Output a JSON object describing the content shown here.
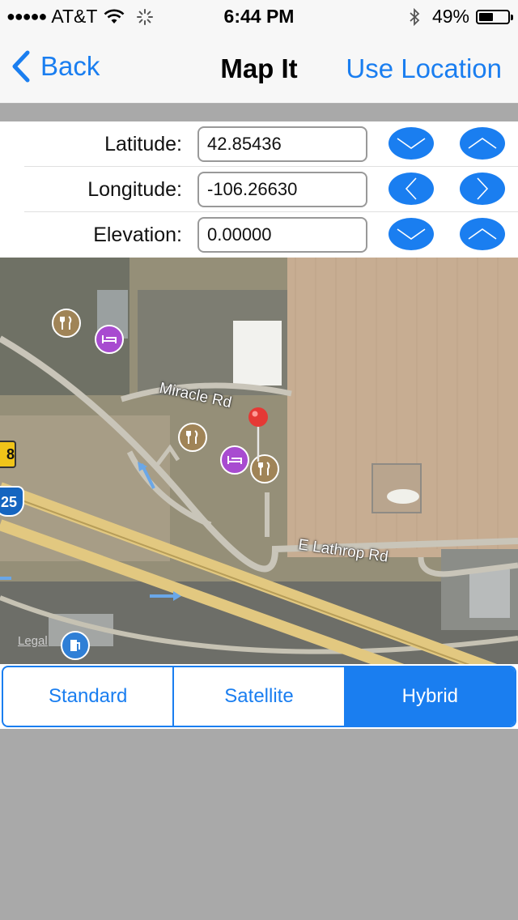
{
  "status_bar": {
    "signal": "●●●●●",
    "carrier": "AT&T",
    "time": "6:44 PM",
    "battery_text": "49%",
    "battery_level": 0.49
  },
  "nav": {
    "back_label": "Back",
    "title": "Map It",
    "right_label": "Use Location"
  },
  "coordinates": {
    "latitude": {
      "label": "Latitude:",
      "value": "42.85436"
    },
    "longitude": {
      "label": "Longitude:",
      "value": "-106.26630"
    },
    "elevation": {
      "label": "Elevation:",
      "value": "0.00000"
    }
  },
  "map": {
    "roads": [
      "Miracle Rd",
      "E Lathrop Rd"
    ],
    "shields": [
      "8",
      "25"
    ],
    "legal": "Legal",
    "colors": {
      "pin": "#e53935",
      "food_poi": "#a08457",
      "hotel_poi": "#a84bd0",
      "fuel_poi": "#2f7fd6"
    }
  },
  "segmented": {
    "items": [
      "Standard",
      "Satellite",
      "Hybrid"
    ],
    "selected": "Hybrid"
  },
  "colors": {
    "accent": "#1a7ef0",
    "background": "#a9a9a9"
  }
}
